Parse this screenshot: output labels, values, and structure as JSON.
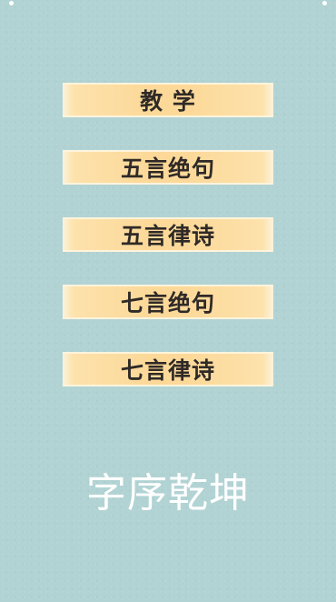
{
  "menu": {
    "items": [
      {
        "label": "教 学"
      },
      {
        "label": "五言绝句"
      },
      {
        "label": "五言律诗"
      },
      {
        "label": "七言绝句"
      },
      {
        "label": "七言律诗"
      }
    ]
  },
  "app": {
    "title": "字序乾坤"
  },
  "colors": {
    "background": "#b2d3d4",
    "button": "#fcd999",
    "button_text": "#2f2a27",
    "title_text": "#ffffff"
  }
}
